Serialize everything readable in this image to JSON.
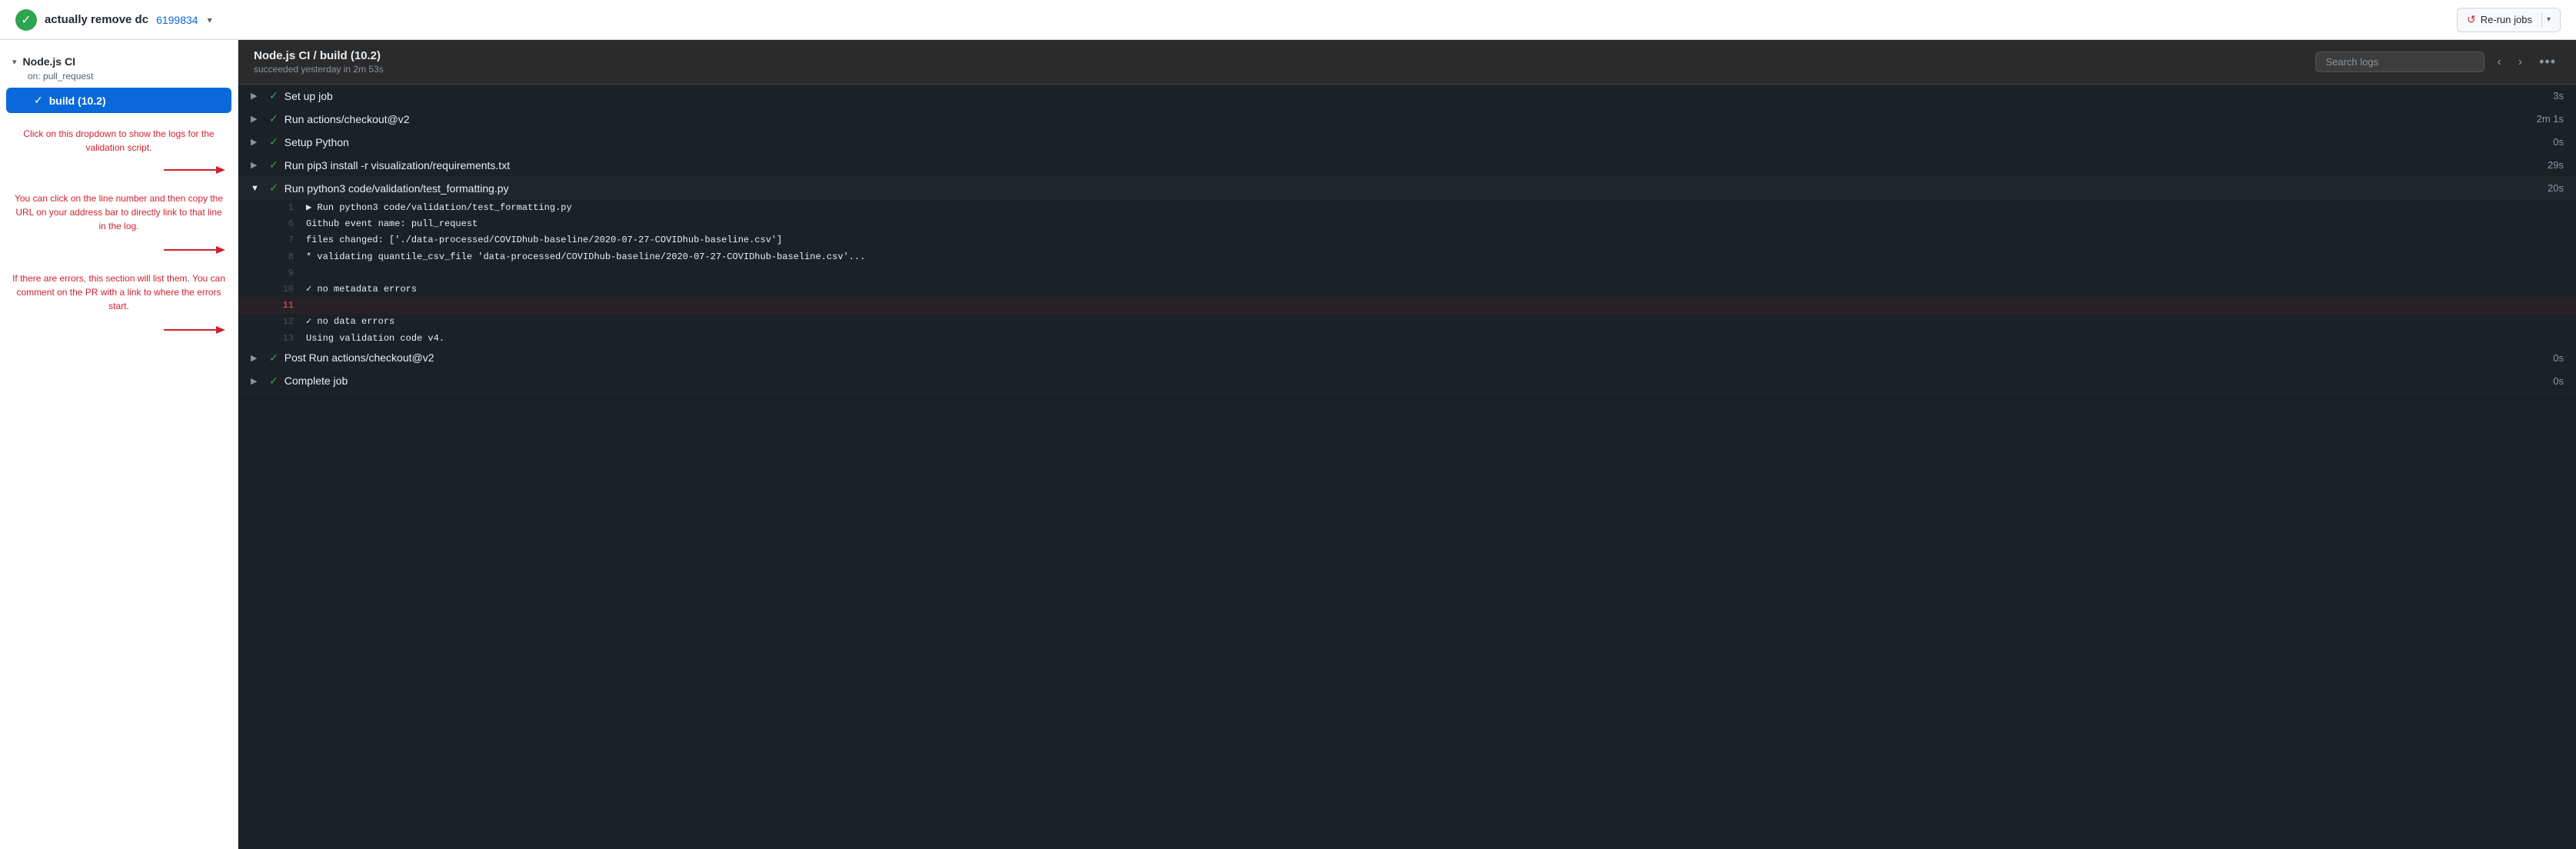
{
  "header": {
    "status": "success",
    "commit_title": "actually remove dc",
    "commit_id": "6199834",
    "rerun_label": "Re-run jobs"
  },
  "sidebar": {
    "workflow_name": "Node.js CI",
    "workflow_trigger": "on: pull_request",
    "jobs": [
      {
        "id": "build-10-2",
        "label": "build (10.2)",
        "active": true
      }
    ]
  },
  "annotations": [
    {
      "id": "annot-dropdown",
      "text": "Click on this dropdown to show the logs for the validation script."
    },
    {
      "id": "annot-line-number",
      "text": "You can click on the line number and then copy the URL on your address bar to directly link to that line in the log."
    },
    {
      "id": "annot-errors",
      "text": "If there are errors, this section will list them. You can comment on the PR with a link to where the errors start."
    }
  ],
  "log_panel": {
    "title": "Node.js CI / build (10.2)",
    "subtitle": "succeeded yesterday in 2m 53s",
    "search_placeholder": "Search logs",
    "steps": [
      {
        "id": "step-setup",
        "name": "Set up job",
        "duration": "3s",
        "expanded": false
      },
      {
        "id": "step-checkout",
        "name": "Run actions/checkout@v2",
        "duration": "2m 1s",
        "expanded": false
      },
      {
        "id": "step-python",
        "name": "Setup Python",
        "duration": "0s",
        "expanded": false
      },
      {
        "id": "step-pip",
        "name": "Run pip3 install -r visualization/requirements.txt",
        "duration": "29s",
        "expanded": false
      },
      {
        "id": "step-validation",
        "name": "Run python3 code/validation/test_formatting.py",
        "duration": "20s",
        "expanded": true
      },
      {
        "id": "step-post",
        "name": "Post Run actions/checkout@v2",
        "duration": "0s",
        "expanded": false
      },
      {
        "id": "step-complete",
        "name": "Complete job",
        "duration": "0s",
        "expanded": false
      }
    ],
    "log_lines": [
      {
        "num": 1,
        "content": "▶ Run python3 code/validation/test_formatting.py",
        "triangle": true
      },
      {
        "num": 6,
        "content": "Github event name: pull_request"
      },
      {
        "num": 7,
        "content": "files changed: ['./data-processed/COVIDhub-baseline/2020-07-27-COVIDhub-baseline.csv']"
      },
      {
        "num": 8,
        "content": "* validating quantile_csv_file 'data-processed/COVIDhub-baseline/2020-07-27-COVIDhub-baseline.csv'..."
      },
      {
        "num": 9,
        "content": ""
      },
      {
        "num": 10,
        "content": "✓ no metadata errors"
      },
      {
        "num": 11,
        "content": ""
      },
      {
        "num": 12,
        "content": "✓ no data errors"
      },
      {
        "num": 13,
        "content": "Using validation code v4."
      }
    ]
  }
}
